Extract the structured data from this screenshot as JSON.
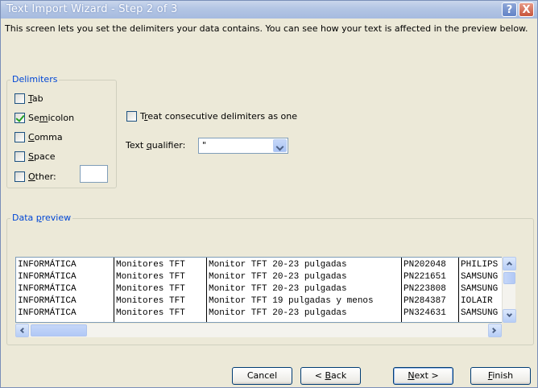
{
  "window": {
    "title": "Text Import Wizard - Step 2 of 3",
    "help_glyph": "?",
    "close_glyph": "X"
  },
  "description": "This screen lets you set the delimiters your data contains.  You can see how your text is affected in the preview below.",
  "delimiters": {
    "group_label": "Delimiters",
    "tab": {
      "pre": "",
      "key": "T",
      "post": "ab",
      "checked": false
    },
    "semicolon": {
      "pre": "Se",
      "key": "m",
      "post": "icolon",
      "checked": true
    },
    "comma": {
      "pre": "",
      "key": "C",
      "post": "omma",
      "checked": false
    },
    "space": {
      "pre": "",
      "key": "S",
      "post": "pace",
      "checked": false
    },
    "other": {
      "pre": "",
      "key": "O",
      "post": "ther:",
      "checked": false,
      "value": ""
    }
  },
  "treat_consecutive": {
    "pre": "T",
    "key": "r",
    "post": "eat consecutive delimiters as one",
    "checked": false
  },
  "text_qualifier": {
    "pre": "Text ",
    "key": "q",
    "post": "ualifier:",
    "value": "\""
  },
  "preview": {
    "group_label_pre": "Data ",
    "group_label_key": "p",
    "group_label_post": "review",
    "rows": [
      [
        "INFORMÁTICA",
        "Monitores TFT",
        "Monitor TFT 20-23 pulgadas",
        "PN202048",
        "PHILIPS"
      ],
      [
        "INFORMÁTICA",
        "Monitores TFT",
        "Monitor TFT 20-23 pulgadas",
        "PN221651",
        "SAMSUNG"
      ],
      [
        "INFORMÁTICA",
        "Monitores TFT",
        "Monitor TFT 20-23 pulgadas",
        "PN223808",
        "SAMSUNG"
      ],
      [
        "INFORMÁTICA",
        "Monitores TFT",
        "Monitor TFT 19 pulgadas y menos",
        "PN284387",
        "IOLAIR"
      ],
      [
        "INFORMÁTICA",
        "Monitores TFT",
        "Monitor TFT 20-23 pulgadas",
        "PN324631",
        "SAMSUNG"
      ]
    ]
  },
  "buttons": {
    "cancel": {
      "pre": "Cancel",
      "key": "",
      "post": ""
    },
    "back": {
      "pre": "< ",
      "key": "B",
      "post": "ack"
    },
    "next": {
      "pre": "",
      "key": "N",
      "post": "ext >"
    },
    "finish": {
      "pre": "",
      "key": "F",
      "post": "inish"
    }
  }
}
